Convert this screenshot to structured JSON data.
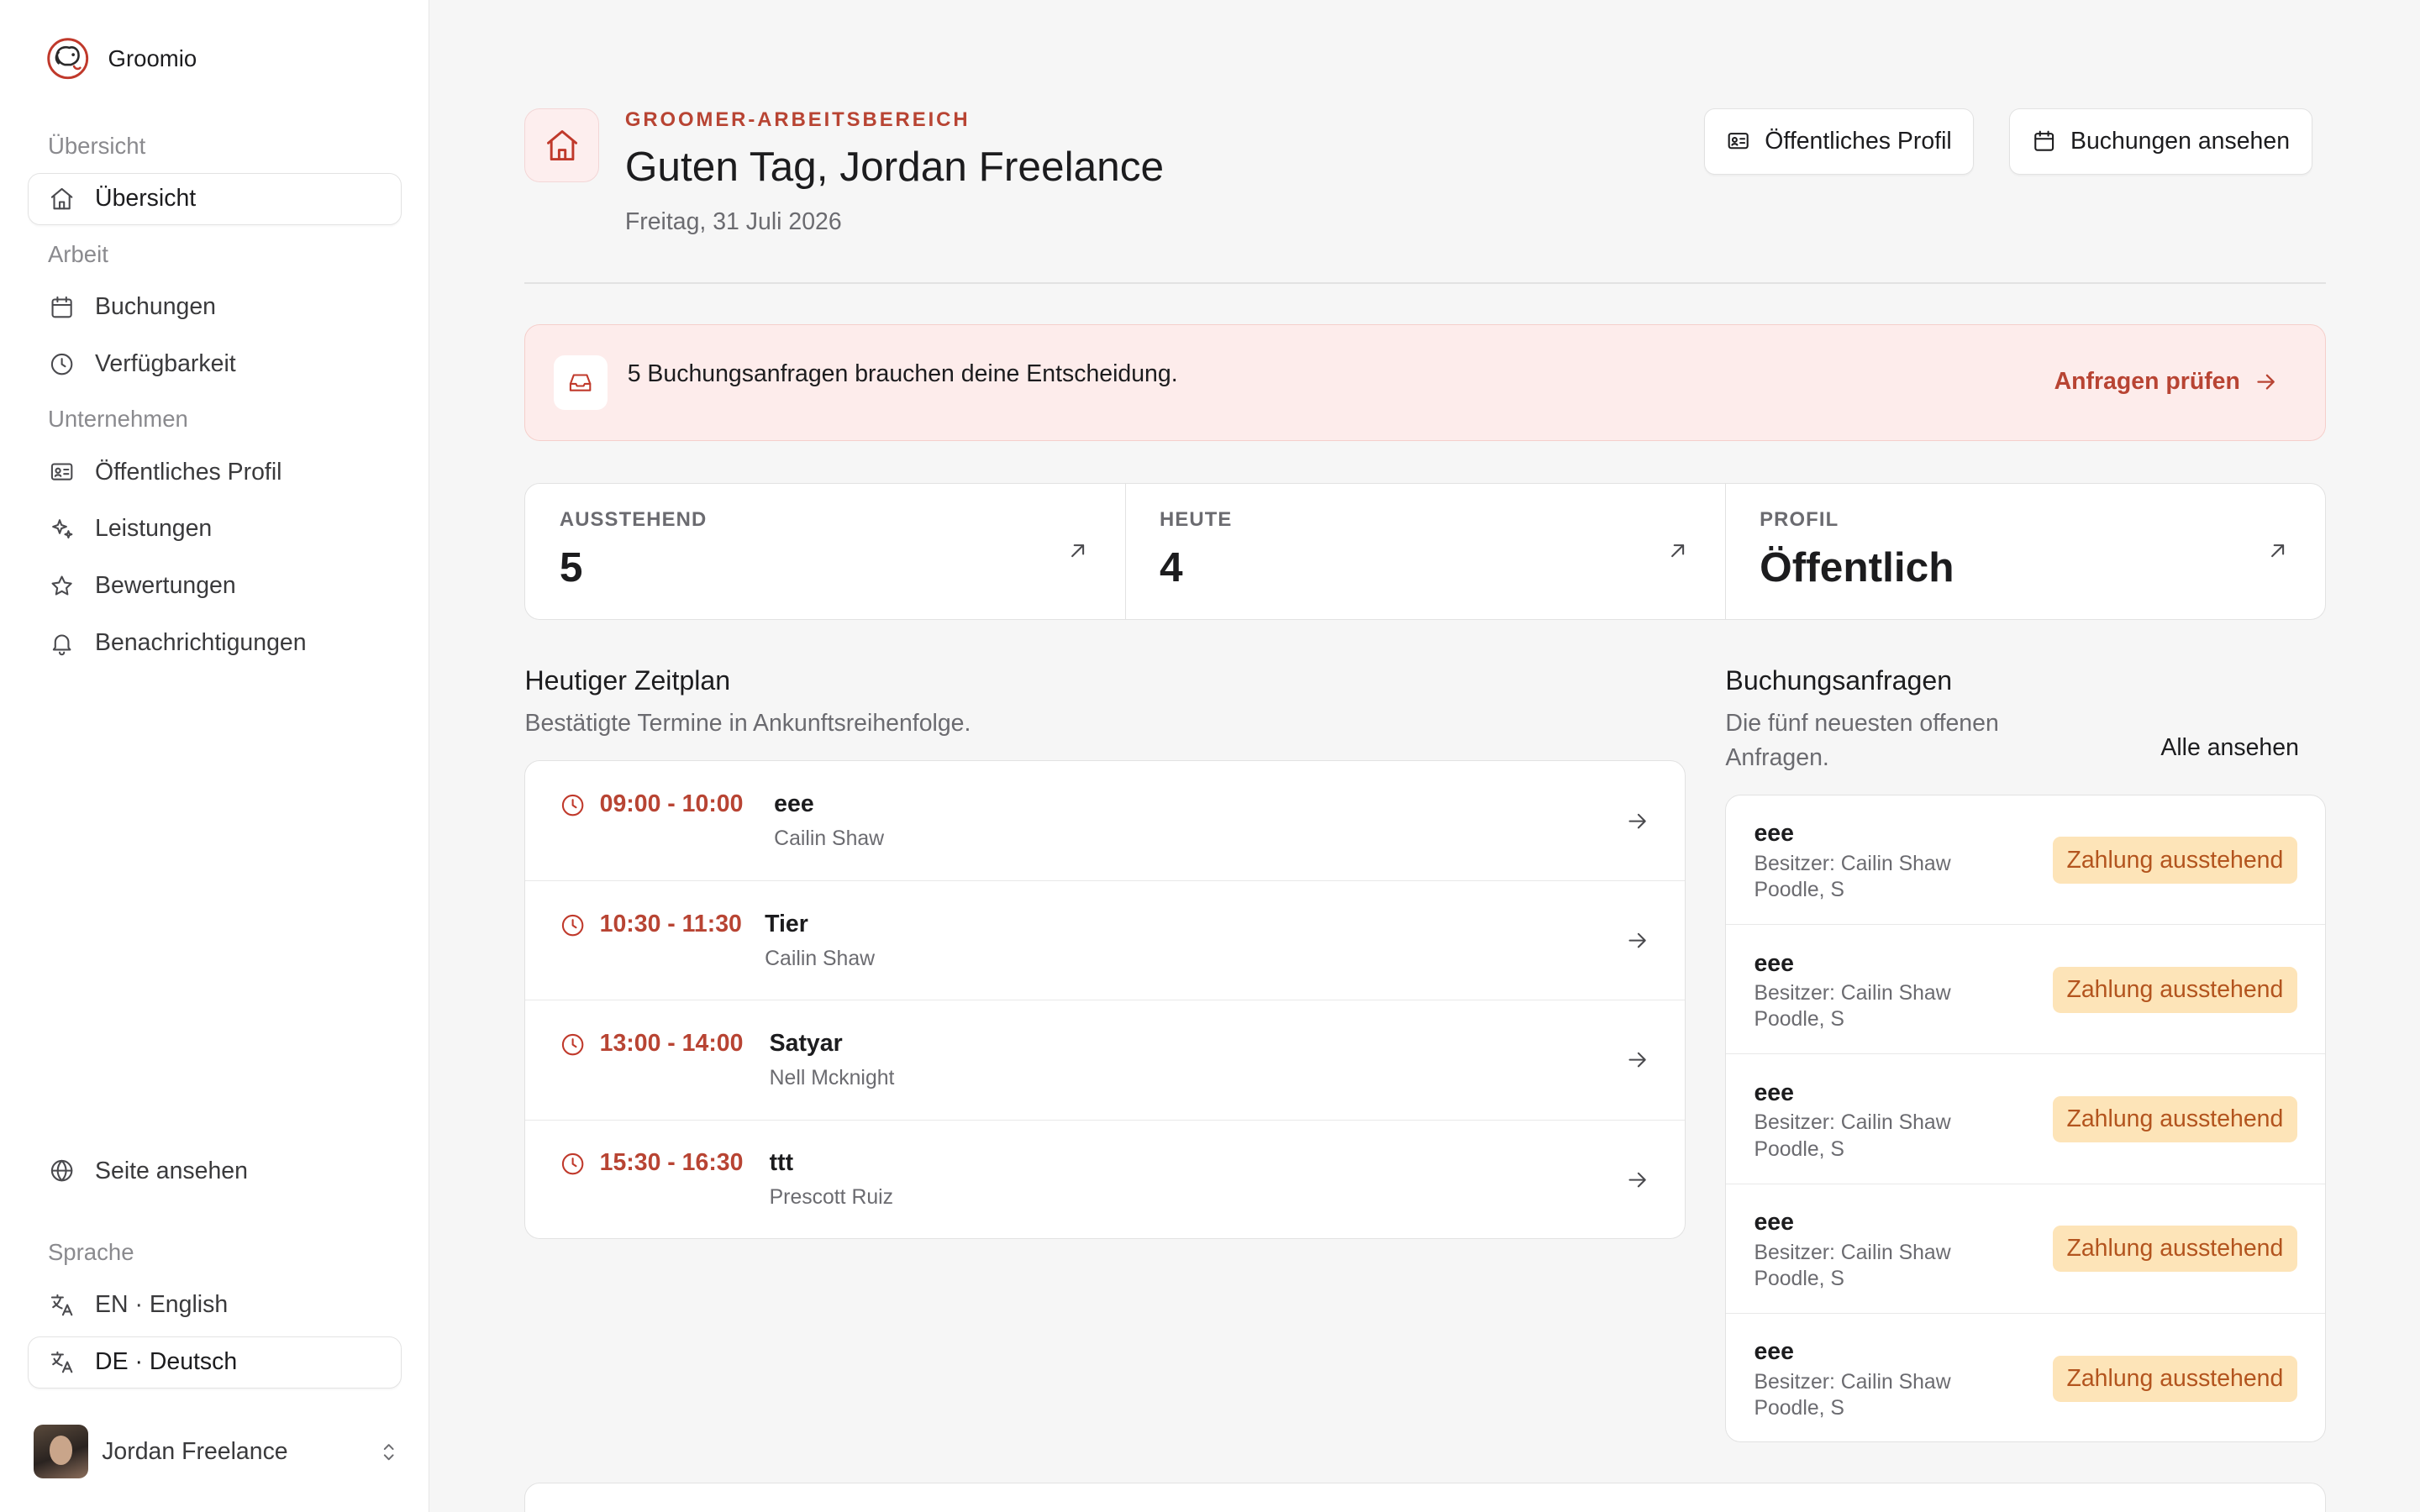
{
  "brand": {
    "name": "Groomio"
  },
  "sidebar": {
    "sections": {
      "overview": "Übersicht",
      "work": "Arbeit",
      "business": "Unternehmen",
      "language": "Sprache"
    },
    "items": {
      "overview": "Übersicht",
      "bookings": "Buchungen",
      "availability": "Verfügbarkeit",
      "public_profile": "Öffentliches Profil",
      "services": "Leistungen",
      "reviews": "Bewertungen",
      "notifications": "Benachrichtigungen",
      "view_site": "Seite ansehen",
      "lang_en": "EN · English",
      "lang_de": "DE · Deutsch"
    },
    "user": {
      "name": "Jordan Freelance"
    }
  },
  "header": {
    "eyebrow": "GROOMER-ARBEITSBEREICH",
    "greeting": "Guten Tag, Jordan Freelance",
    "date": "Freitag, 31 Juli 2026",
    "btn_profile": "Öffentliches Profil",
    "btn_bookings": "Buchungen ansehen"
  },
  "alert": {
    "text": "5 Buchungsanfragen brauchen deine Entscheidung.",
    "link": "Anfragen prüfen"
  },
  "stats": [
    {
      "label": "AUSSTEHEND",
      "value": "5"
    },
    {
      "label": "HEUTE",
      "value": "4"
    },
    {
      "label": "PROFIL",
      "value": "Öffentlich"
    }
  ],
  "schedule": {
    "title": "Heutiger Zeitplan",
    "subtitle": "Bestätigte Termine in Ankunftsreihenfolge.",
    "rows": [
      {
        "time": "09:00 - 10:00",
        "title": "eee",
        "client": "Cailin Shaw"
      },
      {
        "time": "10:30 - 11:30",
        "title": "Tier",
        "client": "Cailin Shaw"
      },
      {
        "time": "13:00 - 14:00",
        "title": "Satyar",
        "client": "Nell Mcknight"
      },
      {
        "time": "15:30 - 16:30",
        "title": "ttt",
        "client": "Prescott Ruiz"
      }
    ]
  },
  "requests": {
    "title": "Buchungsanfragen",
    "subtitle": "Die fünf neuesten offenen Anfragen.",
    "see_all": "Alle ansehen",
    "rows": [
      {
        "title": "eee",
        "owner": "Besitzer: Cailin Shaw",
        "pet": "Poodle, S",
        "status": "Zahlung ausstehend"
      },
      {
        "title": "eee",
        "owner": "Besitzer: Cailin Shaw",
        "pet": "Poodle, S",
        "status": "Zahlung ausstehend"
      },
      {
        "title": "eee",
        "owner": "Besitzer: Cailin Shaw",
        "pet": "Poodle, S",
        "status": "Zahlung ausstehend"
      },
      {
        "title": "eee",
        "owner": "Besitzer: Cailin Shaw",
        "pet": "Poodle, S",
        "status": "Zahlung ausstehend"
      },
      {
        "title": "eee",
        "owner": "Besitzer: Cailin Shaw",
        "pet": "Poodle, S",
        "status": "Zahlung ausstehend"
      }
    ]
  },
  "colors": {
    "accent": "#b84433",
    "alert_bg": "#fdeceb",
    "badge_bg": "#fde4b8",
    "badge_text": "#b3541e"
  },
  "icons": {
    "brand": "dog-logo-icon",
    "overview": "home-icon",
    "bookings": "calendar-icon",
    "availability": "clock-icon",
    "public_profile": "id-card-icon",
    "services": "sparkles-icon",
    "reviews": "star-icon",
    "notifications": "bell-icon",
    "view_site": "globe-icon",
    "language": "translate-icon",
    "alert": "inbox-icon",
    "arrow": "arrow-right-icon",
    "stat": "arrow-up-right-icon"
  }
}
